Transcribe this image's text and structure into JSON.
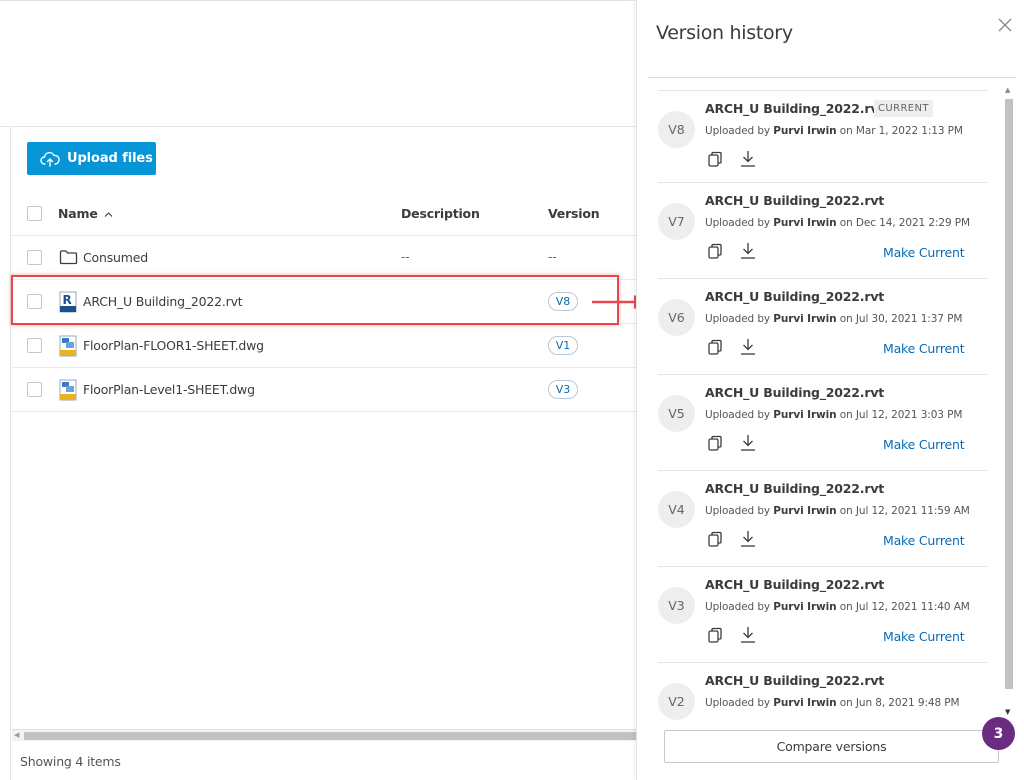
{
  "files": {
    "upload_label": "Upload files",
    "columns": {
      "name": "Name",
      "description": "Description",
      "version": "Version"
    },
    "rows": [
      {
        "name": "Consumed",
        "type": "folder",
        "description": "--",
        "version": "--"
      },
      {
        "name": "ARCH_U Building_2022.rvt",
        "type": "rvt",
        "description": "",
        "version": "V8"
      },
      {
        "name": "FloorPlan-FLOOR1-SHEET.dwg",
        "type": "dwg",
        "description": "",
        "version": "V1"
      },
      {
        "name": "FloorPlan-Level1-SHEET.dwg",
        "type": "dwg",
        "description": "",
        "version": "V3"
      }
    ],
    "footer": "Showing 4 items"
  },
  "panel": {
    "title": "Version history",
    "current_badge": "CURRENT",
    "uploaded_prefix": "Uploaded by",
    "on_word": "on",
    "make_current_label": "Make Current",
    "compare_label": "Compare versions",
    "versions": [
      {
        "badge": "V8",
        "name": "ARCH_U Building_2022.rvt",
        "user": "Purvi Irwin",
        "date": "Mar 1, 2022 1:13 PM",
        "current": true
      },
      {
        "badge": "V7",
        "name": "ARCH_U Building_2022.rvt",
        "user": "Purvi Irwin",
        "date": "Dec 14, 2021 2:29 PM",
        "current": false
      },
      {
        "badge": "V6",
        "name": "ARCH_U Building_2022.rvt",
        "user": "Purvi Irwin",
        "date": "Jul 30, 2021 1:37 PM",
        "current": false
      },
      {
        "badge": "V5",
        "name": "ARCH_U Building_2022.rvt",
        "user": "Purvi Irwin",
        "date": "Jul 12, 2021 3:03 PM",
        "current": false
      },
      {
        "badge": "V4",
        "name": "ARCH_U Building_2022.rvt",
        "user": "Purvi Irwin",
        "date": "Jul 12, 2021 11:59 AM",
        "current": false
      },
      {
        "badge": "V3",
        "name": "ARCH_U Building_2022.rvt",
        "user": "Purvi Irwin",
        "date": "Jul 12, 2021 11:40 AM",
        "current": false
      },
      {
        "badge": "V2",
        "name": "ARCH_U Building_2022.rvt",
        "user": "Purvi Irwin",
        "date": "Jun 8, 2021 9:48 PM",
        "current": false
      }
    ]
  },
  "step_badge": "3",
  "colors": {
    "accent_blue": "#0696d7",
    "link_blue": "#0a6cb3",
    "highlight_red": "#e44a4f",
    "step_purple": "#6a2c81"
  },
  "icons": [
    "upload-cloud-icon",
    "folder-icon",
    "rvt-file-icon",
    "dwg-file-icon",
    "close-icon",
    "copy-icon",
    "download-icon",
    "sort-ascending-icon",
    "red-arrow-icon"
  ]
}
